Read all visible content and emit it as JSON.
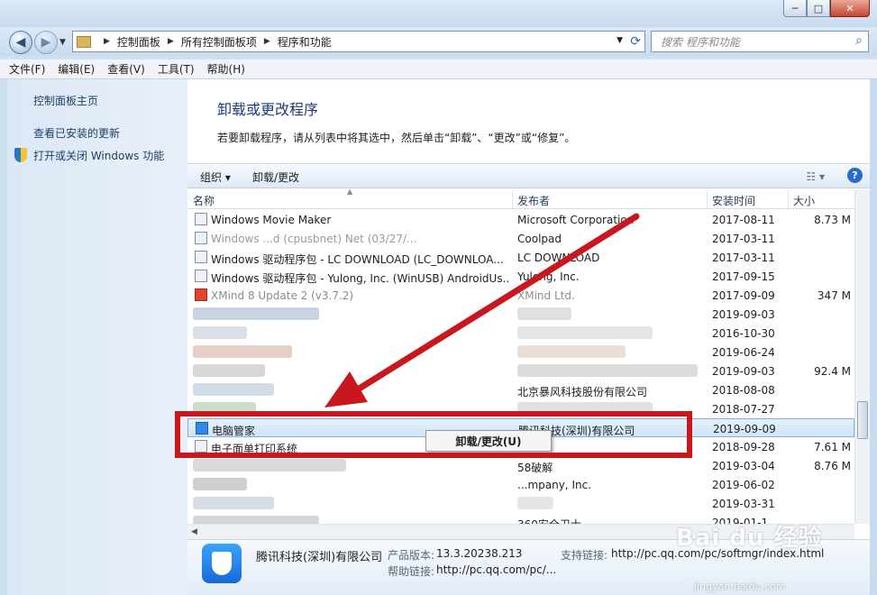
{
  "window": {
    "minimize": "─",
    "maximize": "□",
    "close": "✕"
  },
  "nav": {
    "breadcrumb": [
      "控制面板",
      "所有控制面板项",
      "程序和功能"
    ],
    "search_placeholder": "搜索 程序和功能"
  },
  "menu": [
    "文件(F)",
    "编辑(E)",
    "查看(V)",
    "工具(T)",
    "帮助(H)"
  ],
  "sidebar": {
    "home": "控制面板主页",
    "updates": "查看已安装的更新",
    "features": "打开或关闭 Windows 功能"
  },
  "main": {
    "title": "卸载或更改程序",
    "description": "若要卸载程序，请从列表中将其选中，然后单击“卸载”、“更改”或“修复”。"
  },
  "toolbar": {
    "organize": "组织 ▾",
    "uninstall": "卸载/更改"
  },
  "columns": {
    "name": "名称",
    "publisher": "发布者",
    "installed": "安装时间",
    "size": "大小"
  },
  "rows": [
    {
      "name": "Windows Movie Maker",
      "publisher": "Microsoft Corporation",
      "date": "2017-08-11",
      "size": "8.73 M"
    },
    {
      "name": "Windows ...d (cpusbnet) Net  (03/27/...",
      "publisher": "Coolpad",
      "date": "2017-03-11",
      "size": ""
    },
    {
      "name": "Windows 驱动程序包 - LC DOWNLOAD (LC_DOWNLOA...",
      "publisher": "LC DOWNLOAD",
      "date": "2017-03-11",
      "size": ""
    },
    {
      "name": "Windows 驱动程序包 - Yulong, Inc. (WinUSB) AndroidUs...",
      "publisher": "Yulong, Inc.",
      "date": "2017-09-15",
      "size": ""
    },
    {
      "name": "XMind 8 Update 2 (v3.7.2)",
      "publisher": "XMind Ltd.",
      "date": "2017-09-09",
      "size": "347 M"
    },
    {
      "name": "",
      "publisher": "",
      "date": "2019-09-03",
      "size": ""
    },
    {
      "name": "",
      "publisher": "",
      "date": "2016-10-30",
      "size": ""
    },
    {
      "name": "",
      "publisher": "",
      "date": "2019-06-24",
      "size": ""
    },
    {
      "name": "",
      "publisher": "",
      "date": "2019-09-03",
      "size": "92.4 M"
    },
    {
      "name": "",
      "publisher": "北京暴风科技股份有限公司",
      "date": "2018-08-08",
      "size": ""
    },
    {
      "name": "",
      "publisher": "",
      "date": "2018-07-27",
      "size": ""
    },
    {
      "name": "电脑管家",
      "publisher": "腾讯科技(深圳)有限公司",
      "date": "2019-09-09",
      "size": ""
    },
    {
      "name": "电子面单打印系统",
      "publisher": "",
      "date": "2018-09-28",
      "size": "7.61 M"
    },
    {
      "name": "",
      "publisher": "58破解",
      "date": "2019-03-04",
      "size": "8.76 M"
    },
    {
      "name": "",
      "publisher": "...mpany, Inc.",
      "date": "2019-06-02",
      "size": ""
    },
    {
      "name": "",
      "publisher": "",
      "date": "2019-03-31",
      "size": ""
    },
    {
      "name": "",
      "publisher": "360安全卫士",
      "date": "2019-01-1...",
      "size": ""
    }
  ],
  "context_menu": {
    "uninstall": "卸载/更改(U)"
  },
  "details": {
    "publisher": "腾讯科技(深圳)有限公司",
    "version_label": "产品版本:",
    "version": "13.3.20238.213",
    "support_label": "支持链接:",
    "support": "http://pc.qq.com/pc/softmgr/index.html",
    "help_label": "帮助链接:",
    "help": "http://pc.qq.com/pc/..."
  },
  "watermark": {
    "brand": "Bai du 经验",
    "url": "jingyan.baidu.com"
  },
  "colors": {
    "annotation": "#c8171f",
    "selected_row": "#cfe4f8",
    "link": "#1e3c77"
  }
}
